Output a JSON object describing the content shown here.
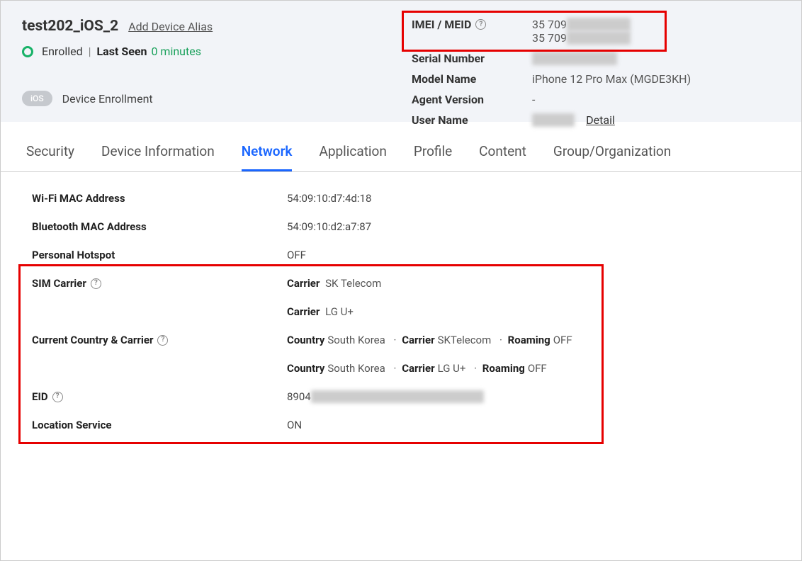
{
  "header": {
    "device_name": "test202_iOS_2",
    "alias_link": "Add Device Alias",
    "status": "Enrolled",
    "last_seen_label": "Last Seen",
    "last_seen_value": "0 minutes",
    "os_badge": "iOS",
    "enrollment_label": "Device Enrollment"
  },
  "info": {
    "imei_label": "IMEI / MEID",
    "imei1_prefix": "35 709",
    "imei2_prefix": "35 709",
    "serial_label": "Serial Number",
    "model_label": "Model Name",
    "model_value": "iPhone 12 Pro Max (MGDE3KH)",
    "agent_label": "Agent Version",
    "agent_value": "-",
    "user_label": "User Name",
    "detail_link": "Detail"
  },
  "tabs": {
    "security": "Security",
    "device_info": "Device Information",
    "network": "Network",
    "application": "Application",
    "profile": "Profile",
    "content": "Content",
    "group": "Group/Organization"
  },
  "network": {
    "wifi_label": "Wi-Fi MAC Address",
    "wifi_value": "54:09:10:d7:4d:18",
    "bt_label": "Bluetooth MAC Address",
    "bt_value": "54:09:10:d2:a7:87",
    "hotspot_label": "Personal Hotspot",
    "hotspot_value": "OFF",
    "sim_label": "SIM Carrier",
    "sim_carrier_key": "Carrier",
    "sim_carrier1": "SK Telecom",
    "sim_carrier2": "LG U+",
    "cc_label": "Current Country & Carrier",
    "cc_country_key": "Country",
    "cc_carrier_key": "Carrier",
    "cc_roaming_key": "Roaming",
    "cc1_country": "South Korea",
    "cc1_carrier": "SKTelecom",
    "cc1_roaming": "OFF",
    "cc2_country": "South Korea",
    "cc2_carrier": "LG U+",
    "cc2_roaming": "OFF",
    "eid_label": "EID",
    "eid_prefix": "8904",
    "loc_label": "Location Service",
    "loc_value": "ON"
  }
}
